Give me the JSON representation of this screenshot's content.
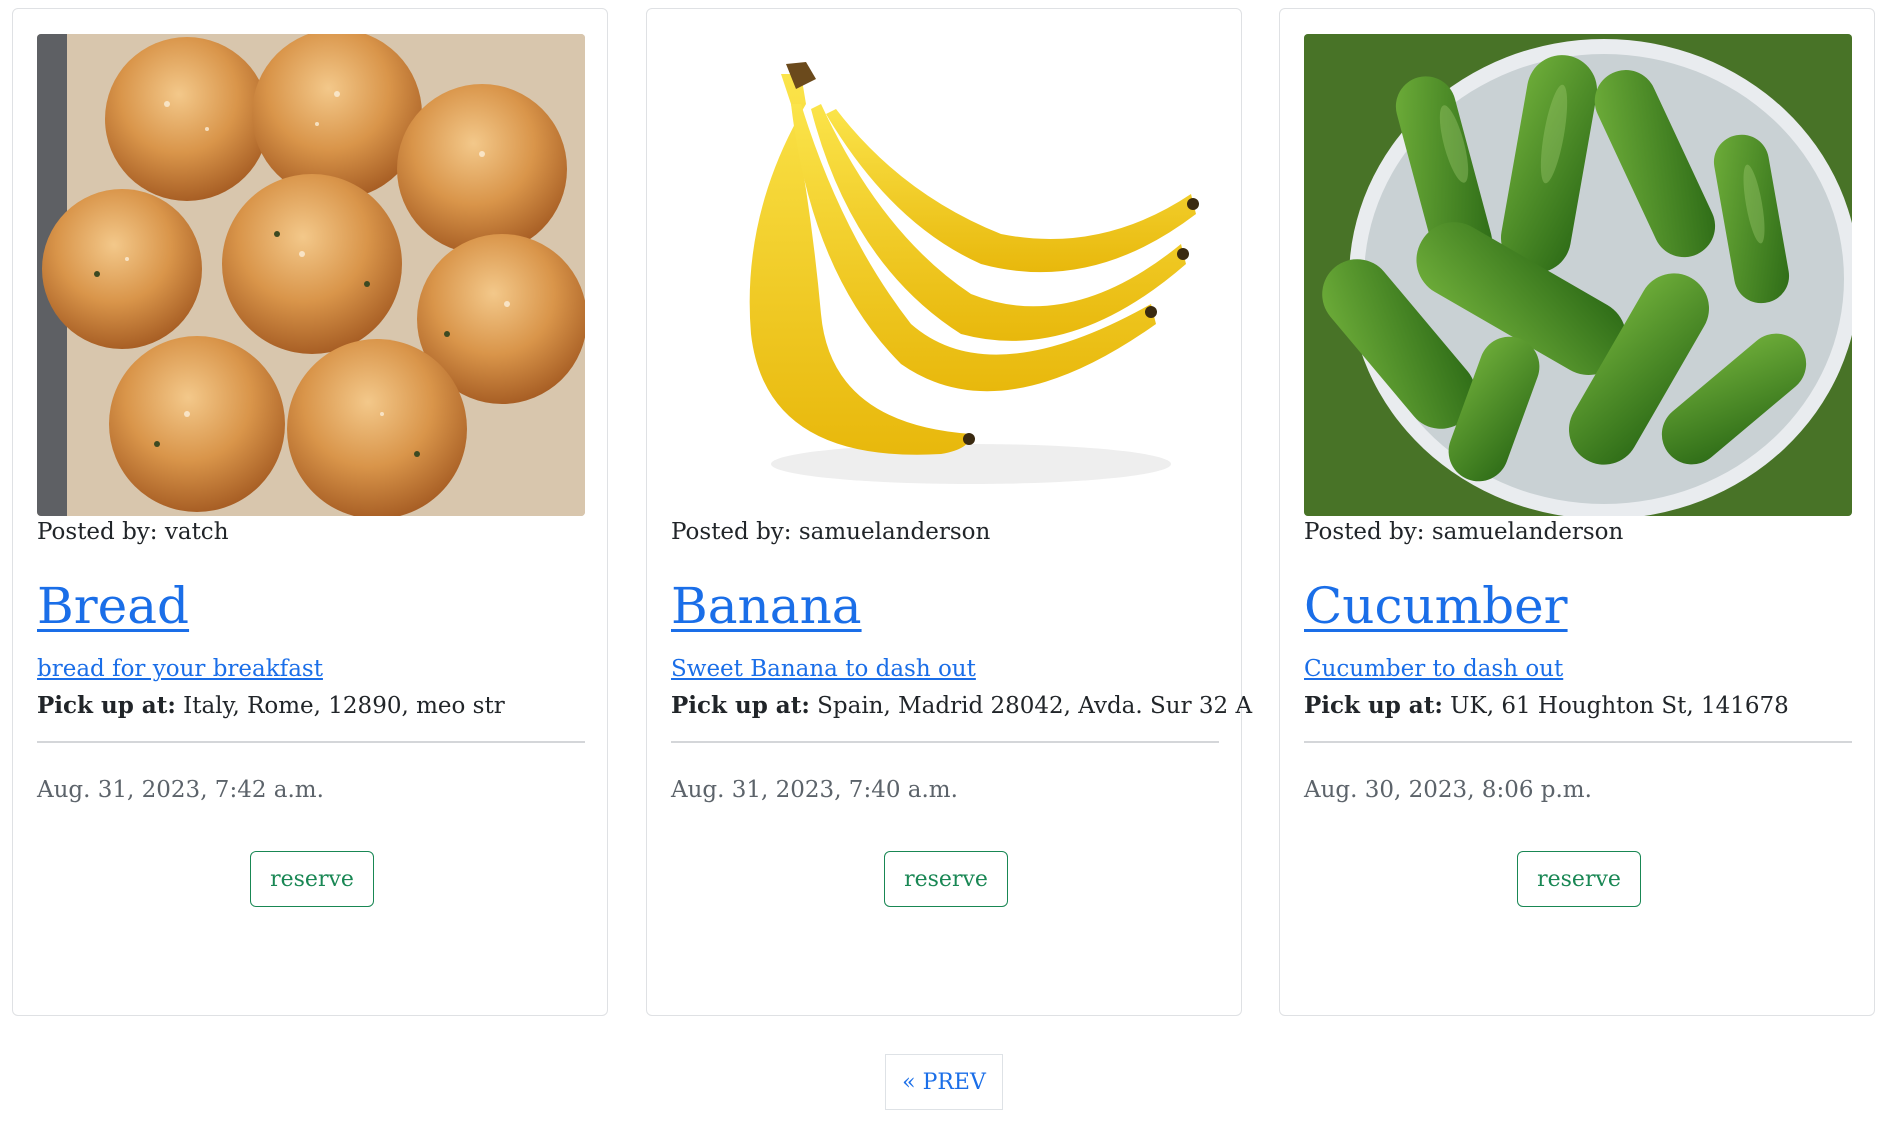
{
  "listings": [
    {
      "image_alt": "bread",
      "posted_by": "Posted by: vatch",
      "title": "Bread",
      "description": "bread for your breakfast",
      "pickup_label": "Pick up at:",
      "pickup_address": "Italy, Rome, 12890, meo str",
      "date": "Aug. 31, 2023, 7:42 a.m.",
      "reserve_label": "reserve"
    },
    {
      "image_alt": "banana",
      "posted_by": "Posted by: samuelanderson",
      "title": "Banana",
      "description": "Sweet Banana to dash out",
      "pickup_label": "Pick up at:",
      "pickup_address": "Spain, Madrid 28042, Avda. Sur 32 A",
      "date": "Aug. 31, 2023, 7:40 a.m.",
      "reserve_label": "reserve"
    },
    {
      "image_alt": "cucumber",
      "posted_by": "Posted by: samuelanderson",
      "title": "Cucumber",
      "description": "Cucumber to dash out",
      "pickup_label": "Pick up at:",
      "pickup_address": "UK, 61 Houghton St, 141678",
      "date": "Aug. 30, 2023, 8:06 p.m.",
      "reserve_label": "reserve"
    }
  ],
  "pagination": {
    "prev_label": "« PREV"
  },
  "colors": {
    "link": "#1a6ee8",
    "reserve": "#198754",
    "border": "#dfe1e4"
  }
}
